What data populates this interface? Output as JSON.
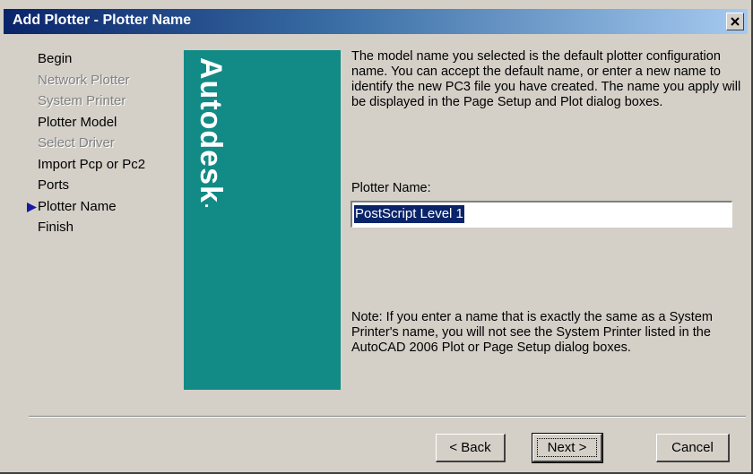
{
  "window": {
    "title": "Add Plotter - Plotter Name",
    "close_icon": "close-icon"
  },
  "steps": [
    {
      "label": "Begin",
      "state": "enabled"
    },
    {
      "label": "Network Plotter",
      "state": "disabled"
    },
    {
      "label": "System Printer",
      "state": "disabled"
    },
    {
      "label": "Plotter Model",
      "state": "enabled"
    },
    {
      "label": "Select Driver",
      "state": "disabled"
    },
    {
      "label": "Import Pcp or Pc2",
      "state": "enabled"
    },
    {
      "label": "Ports",
      "state": "enabled"
    },
    {
      "label": "Plotter Name",
      "state": "current"
    },
    {
      "label": "Finish",
      "state": "enabled"
    }
  ],
  "brand": {
    "text": "Autodesk",
    "mark": ".",
    "color": "#128a85"
  },
  "content": {
    "description": "The model name you selected is the default plotter configuration name. You can accept the default name, or enter a new name to identify the new PC3 file you have created. The name you apply will be displayed in the Page Setup and Plot dialog boxes.",
    "field_label": "Plotter Name:",
    "field_value": "PostScript Level 1",
    "note": "Note: If you enter a name that is exactly the same as a System Printer's name, you will not see the System Printer listed in the AutoCAD 2006 Plot or Page Setup dialog boxes."
  },
  "buttons": {
    "back": "< Back",
    "next": "Next >",
    "cancel": "Cancel"
  },
  "colors": {
    "title_bar": "#0a246a",
    "dialog_bg": "#d4d0c8",
    "selection": "#0a246a",
    "current_step_arrow": "#1a1aa0"
  }
}
